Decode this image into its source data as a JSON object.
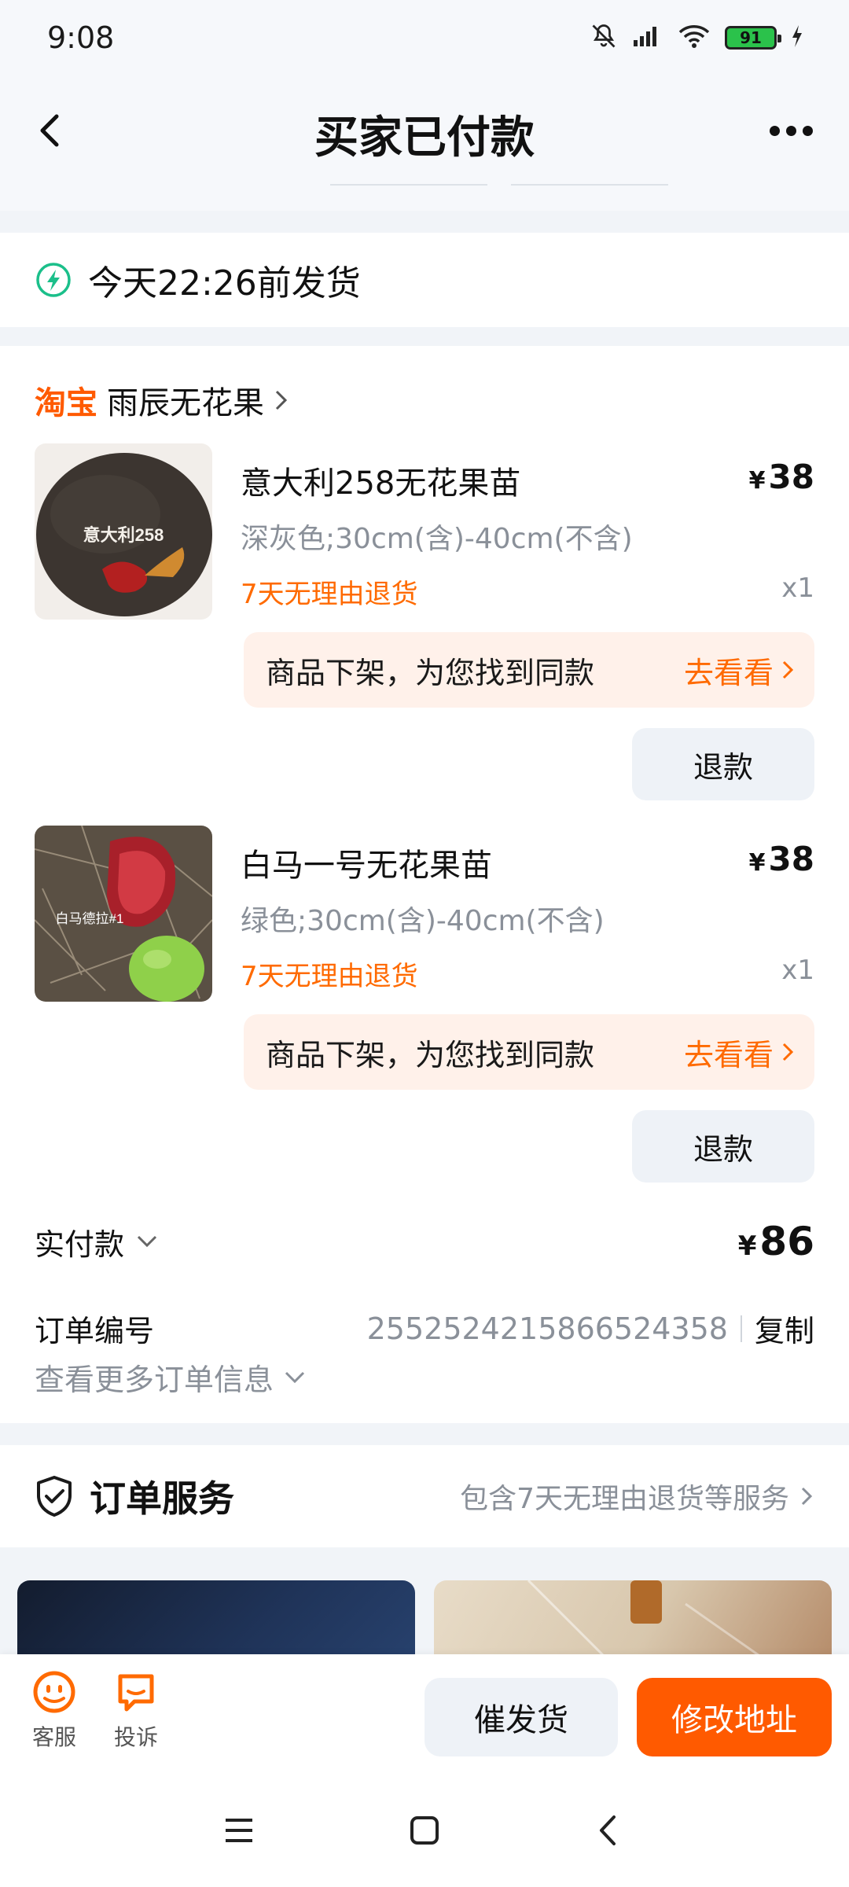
{
  "status_bar": {
    "time": "9:08",
    "battery": "91"
  },
  "header": {
    "title": "买家已付款"
  },
  "shipping": {
    "text": "今天22:26前发货"
  },
  "shop": {
    "logo": "淘宝",
    "name": "雨辰无花果"
  },
  "items": [
    {
      "title": "意大利258无花果苗",
      "price_symbol": "¥",
      "price": "38",
      "spec": "深灰色;30cm(含)-40cm(不含)",
      "tag": "7天无理由退货",
      "qty": "x1",
      "image_label": "意大利258",
      "offshelf_text": "商品下架，为您找到同款",
      "offshelf_link": "去看看",
      "refund_label": "退款"
    },
    {
      "title": "白马一号无花果苗",
      "price_symbol": "¥",
      "price": "38",
      "spec": "绿色;30cm(含)-40cm(不含)",
      "tag": "7天无理由退货",
      "qty": "x1",
      "image_label": "白马德拉#1",
      "offshelf_text": "商品下架，为您找到同款",
      "offshelf_link": "去看看",
      "refund_label": "退款"
    }
  ],
  "payment": {
    "label": "实付款",
    "symbol": "¥",
    "amount": "86"
  },
  "order": {
    "label": "订单编号",
    "number": "2552524215866524358",
    "copy_label": "复制",
    "more_info": "查看更多订单信息"
  },
  "service": {
    "title": "订单服务",
    "summary": "包含7天无理由退货等服务"
  },
  "bottom_bar": {
    "customer_service": "客服",
    "complaint": "投诉",
    "urge_label": "催发货",
    "edit_address_label": "修改地址"
  },
  "colors": {
    "accent": "#ff5a00",
    "tag": "#ff6a00",
    "ship_icon": "#1bbf8a",
    "muted": "#8a9099"
  }
}
